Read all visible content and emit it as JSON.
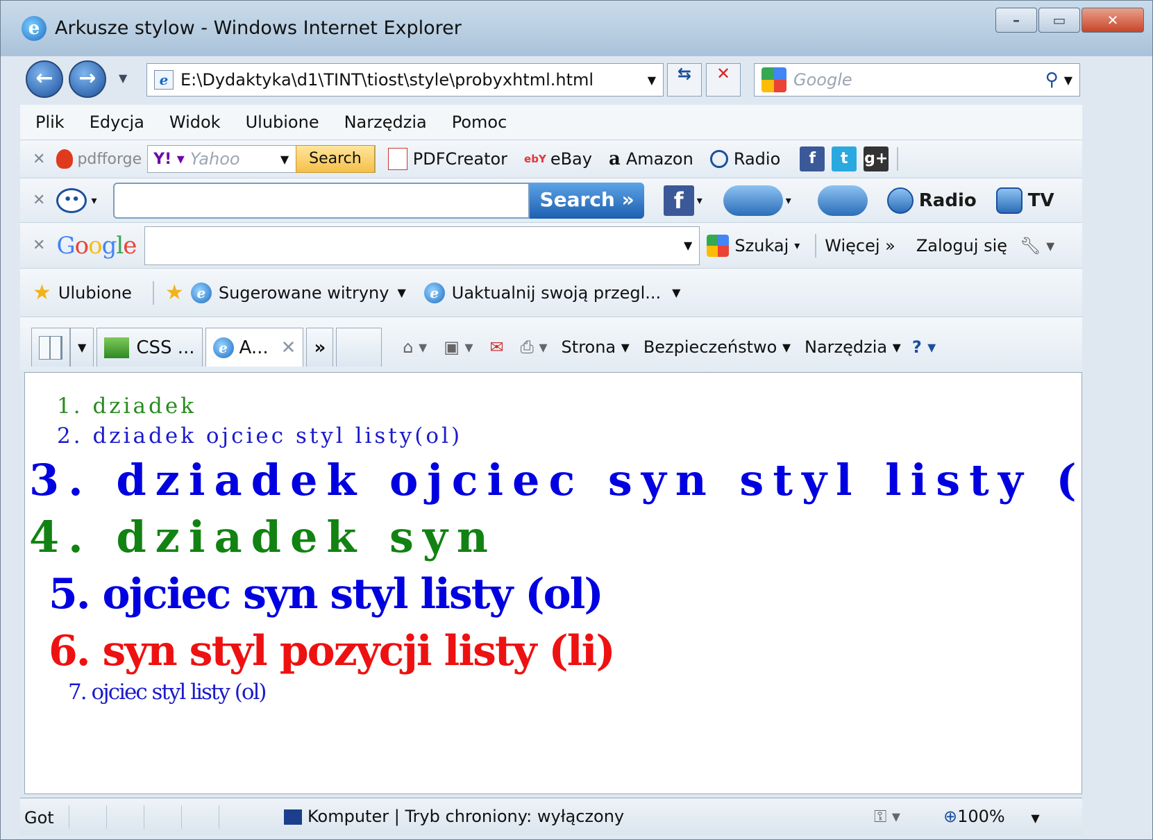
{
  "window": {
    "title": "Arkusze stylow - Windows Internet Explorer"
  },
  "address": {
    "url": "E:\\Dydaktyka\\d1\\TINT\\tiost\\style\\probyxhtml.html",
    "search_placeholder": "Google"
  },
  "menu": [
    "Plik",
    "Edycja",
    "Widok",
    "Ulubione",
    "Narzędzia",
    "Pomoc"
  ],
  "toolbar1": {
    "pdfforge": "pdfforge",
    "yahoo_placeholder": "Yahoo",
    "search_label": "Search",
    "pdfcreator": "PDFCreator",
    "ebay_logo": "ebY",
    "ebay": "eBay",
    "amazon_logo": "a",
    "amazon": "Amazon",
    "radio": "Radio"
  },
  "toolbar2": {
    "search_label": "Search »",
    "radio": "Radio",
    "tv": "TV"
  },
  "toolbar3": {
    "google_logo": "Google",
    "szukaj": "Szukaj",
    "wiecej": "Więcej »",
    "zaloguj": "Zaloguj się"
  },
  "favorites": {
    "ulubione": "Ulubione",
    "sugerowane": "Sugerowane witryny",
    "uaktualnij": "Uaktualnij swoją przegl..."
  },
  "tabs": {
    "tab1": "CSS ...",
    "tab2": "A...",
    "more": "»",
    "strona": "Strona",
    "bezpieczenstwo": "Bezpieczeństwo",
    "narzedzia": "Narzędzia"
  },
  "content": {
    "items": [
      {
        "num": "1.",
        "text": "dziadek",
        "color": "#2a8a1e"
      },
      {
        "num": "2.",
        "text": "dziadek ojciec styl listy(ol)",
        "color": "#1a1acc"
      },
      {
        "num": "3.",
        "text": "dziadek ojciec syn styl listy (ol)",
        "color": "#0000e0"
      },
      {
        "num": "4.",
        "text": "dziadek syn",
        "color": "#128212"
      },
      {
        "num": "5.",
        "text": "ojciec syn styl listy (ol)",
        "color": "#0000e0"
      },
      {
        "num": "6.",
        "text": "syn styl pozycji listy (li)",
        "color": "#ee1111"
      },
      {
        "num": "7.",
        "text": "ojciec styl listy (ol)",
        "color": "#1a1acc"
      }
    ]
  },
  "status": {
    "left": "Got",
    "zone": "Komputer | Tryb chroniony: wyłączony",
    "zoom": "100%"
  }
}
